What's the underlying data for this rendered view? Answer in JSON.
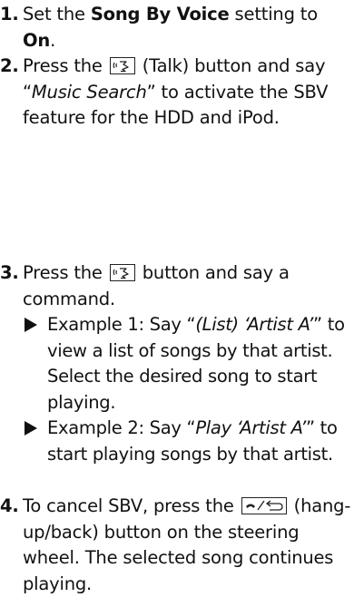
{
  "steps": [
    {
      "num": "1.",
      "t1": "Set the ",
      "b1": "Song By Voice",
      "t2": " setting to ",
      "b2": "On",
      "t3": "."
    },
    {
      "num": "2.",
      "t1": "Press the ",
      "key_label": "(Talk)",
      "t2": " button and say",
      "q_open": "“",
      "q_text": "Music Search",
      "q_close": "”",
      "t3": " to activate the SBV feature for the HDD and iPod."
    },
    {
      "num": "3.",
      "t1": "Press the ",
      "t2": " button and say a command.",
      "examples": [
        {
          "lead": "Example 1: Say “",
          "cmd": "(List) ‘Artist A’",
          "close": "”",
          "rest": " to view a list of songs by that artist. Select the desired song to start playing."
        },
        {
          "lead": "Example 2: Say “",
          "cmd": "Play ‘Artist A’",
          "close": "”",
          "rest": " to start playing songs by that artist."
        }
      ]
    },
    {
      "num": "4.",
      "t1": "To cancel SBV, press the ",
      "t2": " (hang-up/back) button on the steering wheel. The selected song continues playing."
    }
  ],
  "icons": {
    "talk_key": "talk-button-icon",
    "hangup_key": "hang-up-back-button-icon",
    "bullet": "triangle-bullet-icon"
  },
  "colors": {
    "text": "#111111",
    "background": "#ffffff"
  }
}
